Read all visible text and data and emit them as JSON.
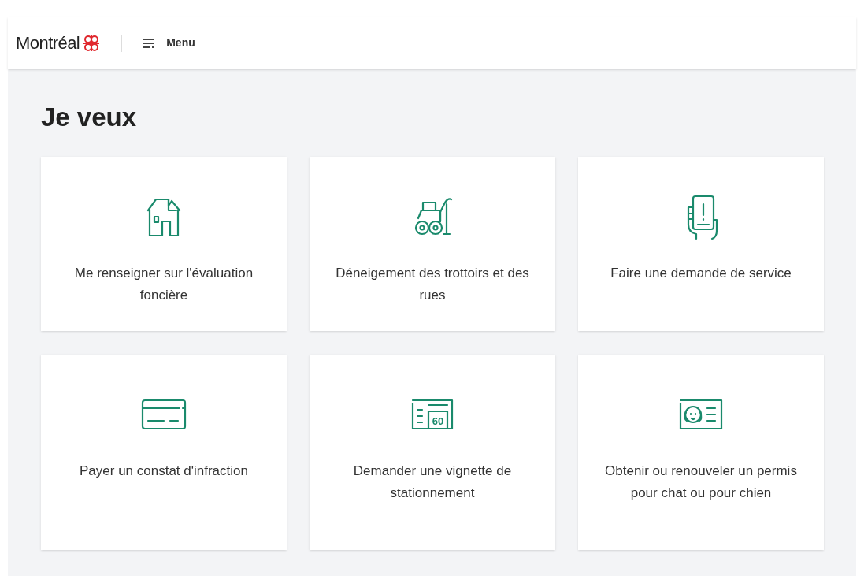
{
  "header": {
    "logo": "Montréal",
    "menu_label": "Menu"
  },
  "heading": "Je veux",
  "cards": [
    {
      "kind": "house",
      "label": "Me renseigner sur l'évaluation foncière"
    },
    {
      "kind": "snowplow",
      "label": "Déneigement des trottoirs et des rues"
    },
    {
      "kind": "phone",
      "label": "Faire une demande de service"
    },
    {
      "kind": "card",
      "label": "Payer un constat d'infraction"
    },
    {
      "kind": "parking",
      "label": "Demander une vignette de stationnement",
      "badge": "60"
    },
    {
      "kind": "pet",
      "label": "Obtenir ou renouveler un permis pour chat ou pour chien"
    }
  ]
}
